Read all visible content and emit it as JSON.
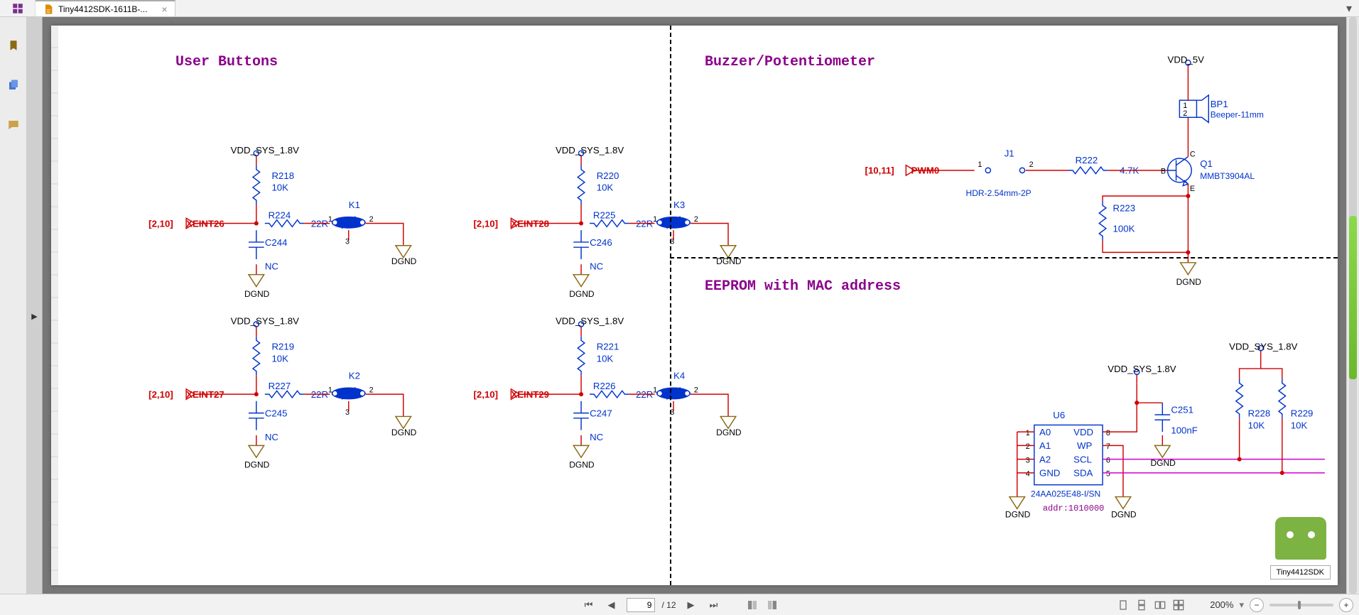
{
  "tab": {
    "title": "Tiny4412SDK-1611B-...",
    "close_tip": "×"
  },
  "bottom": {
    "page_current": "9",
    "page_total": "/ 12",
    "zoom": "200%"
  },
  "robot_label": "Tiny4412SDK",
  "sections": {
    "buttons": "User Buttons",
    "buzzer": "Buzzer/Potentiometer",
    "eeprom": "EEPROM with MAC address"
  },
  "nets": {
    "vdd_sys": "VDD_SYS_1.8V",
    "vdd_5v": "VDD_5V",
    "dgnd": "DGND",
    "xeint26": "XEINT26",
    "xeint27": "XEINT27",
    "xeint28": "XEINT28",
    "xeint29": "XEINT29",
    "pwm0": "PWM0",
    "ref_2_10": "[2,10]",
    "ref_10_11": "[10,11]"
  },
  "parts": {
    "R218": "R218",
    "R219": "R219",
    "R220": "R220",
    "R221": "R221",
    "R222": "R222",
    "R223": "R223",
    "R224": "R224",
    "R225": "R225",
    "R226": "R226",
    "R227": "R227",
    "R228": "R228",
    "R229": "R229",
    "C244": "C244",
    "C245": "C245",
    "C246": "C246",
    "C247": "C247",
    "C251": "C251",
    "K1": "K1",
    "K2": "K2",
    "K3": "K3",
    "K4": "K4",
    "J1": "J1",
    "Q1": "Q1",
    "BP1": "BP1",
    "U6": "U6"
  },
  "vals": {
    "10K": "10K",
    "22R": "22R",
    "NC": "NC",
    "4_7K": "4.7K",
    "100K": "100K",
    "100nF": "100nF",
    "beeper": "Beeper-11mm",
    "mmbt": "MMBT3904AL",
    "hdr": "HDR-2.54mm-2P",
    "eeprom_pn": "24AA025E48-I/SN",
    "addr": "addr:1010000",
    "A0": "A0",
    "A1": "A1",
    "A2": "A2",
    "GND": "GND",
    "VDD": "VDD",
    "WP": "WP",
    "SCL": "SCL",
    "SDA": "SDA",
    "p1": "1",
    "p2": "2",
    "p3": "3",
    "p4": "4",
    "p5": "5",
    "p6": "6",
    "p7": "7",
    "p8": "8",
    "B": "B",
    "C": "C",
    "E": "E"
  }
}
